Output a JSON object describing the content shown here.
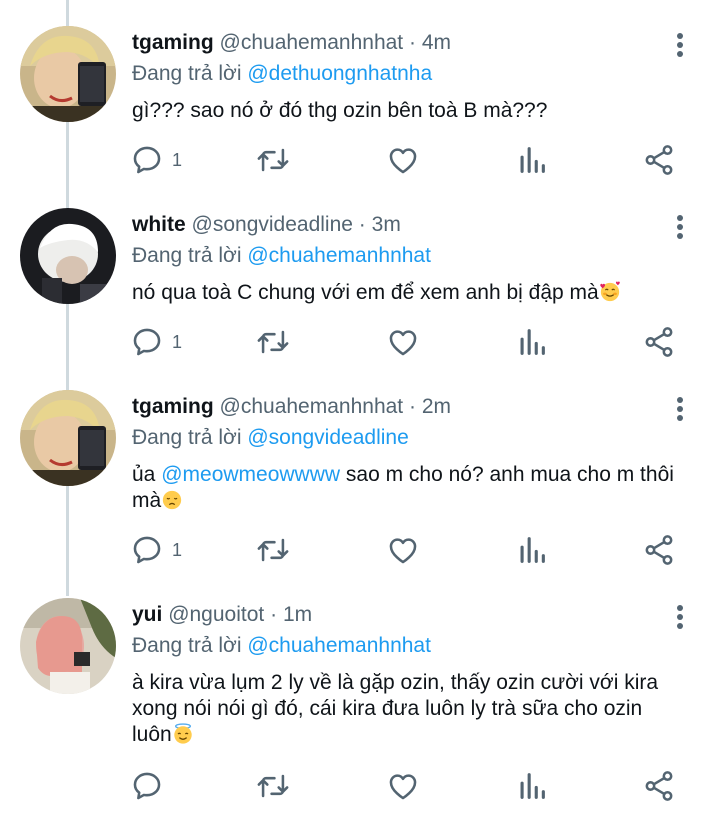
{
  "colors": {
    "text": "#0f1419",
    "secondary": "#536471",
    "link": "#1d9bf0",
    "thread_line": "#cfd9de"
  },
  "reply_prefix": "Đang trả lời",
  "tweets": [
    {
      "name": "tgaming",
      "handle": "@chuahemanhnhat",
      "dot": "·",
      "time": "4m",
      "replying_to": "@dethuongnhatnha",
      "text": "gì??? sao nó ở đó thg ozin bên toà B mà???",
      "reply_count": "1",
      "avatar_icon": "avatar-tgaming"
    },
    {
      "name": "white",
      "handle": "@songvideadline",
      "dot": "·",
      "time": "3m",
      "replying_to": "@chuahemanhnhat",
      "text": "nó qua toà C chung với em để xem anh bị đập mà",
      "text_emoji": "smiling-face-with-hearts",
      "reply_count": "1",
      "avatar_icon": "avatar-white"
    },
    {
      "name": "tgaming",
      "handle": "@chuahemanhnhat",
      "dot": "·",
      "time": "2m",
      "replying_to": "@songvideadline",
      "text_prefix": "ủa ",
      "text_mention": "@meowmeowwww",
      "text_rest": " sao m cho nó? anh mua cho m thôi mà",
      "text_emoji": "disappointed-face",
      "reply_count": "1",
      "avatar_icon": "avatar-tgaming"
    },
    {
      "name": "yui",
      "handle": "@nguoitot",
      "dot": "·",
      "time": "1m",
      "replying_to": "@chuahemanhnhat",
      "text": "à kira vừa lụm 2 ly về là gặp ozin, thấy ozin cười với kira xong nói nói gì đó, cái kira đưa luôn ly trà sữa cho ozin luôn",
      "text_emoji": "smiling-face-with-halo",
      "reply_count": "",
      "avatar_icon": "avatar-yui"
    }
  ],
  "action_icons": [
    "reply-icon",
    "retweet-icon",
    "like-icon",
    "analytics-icon",
    "share-icon"
  ]
}
